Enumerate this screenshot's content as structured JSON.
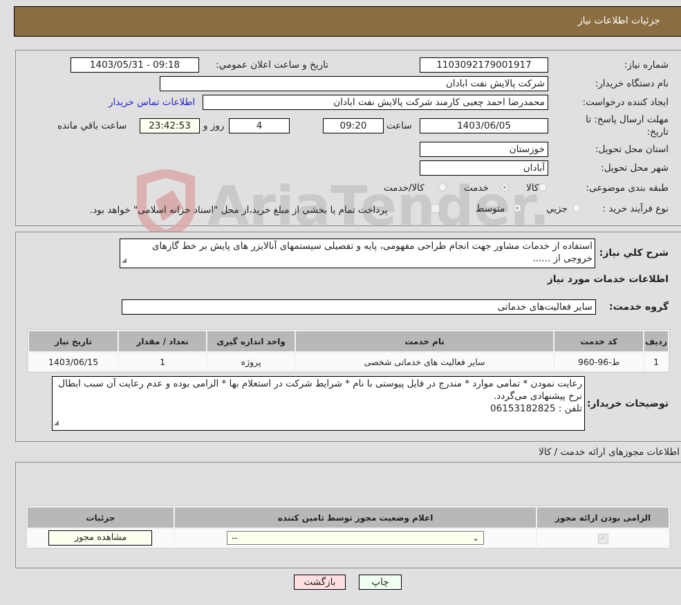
{
  "header": {
    "title": "جزئیات اطلاعات نیاز"
  },
  "details": {
    "need_number_label": "شماره نیاز:",
    "need_number": "1103092179001917",
    "announce_label": "تاریخ و ساعت اعلان عمومي:",
    "announce_value": "1403/05/31 - 09:18",
    "buyer_org_label": "نام دستگاه خریدار:",
    "buyer_org": "شرکت پالایش نفت ابادان",
    "creator_label": "ایجاد کننده درخواست:",
    "creator": "محمدرضا احمد چعبی کارمند شرکت پالایش نفت ابادان",
    "buyer_contact_link": "اطلاعات تماس خریدار",
    "deadline_label": "مهلت ارسال پاسخ: تا تاریخ:",
    "deadline_date": "1403/06/05",
    "time_label": "ساعت",
    "deadline_time": "09:20",
    "days_value": "4",
    "days_label": "روز و",
    "remaining_time": "23:42:53",
    "remaining_label": "ساعت باقي مانده",
    "province_label": "استان محل تحویل:",
    "province": "خوزستان",
    "city_label": "شهر محل تحویل:",
    "city": "آبادان",
    "category_label": "طبقه بندی موضوعی:",
    "category_options": [
      "کالا",
      "خدمت",
      "کالا/خدمت"
    ],
    "category_selected": "خدمت",
    "process_label": "نوع فرآیند خرید :",
    "process_options": [
      "جزيي",
      "متوسط"
    ],
    "process_selected": "متوسط",
    "treasury_note": "پرداخت تمام یا بخشی از مبلغ خرید،از محل \"اسناد خزانه اسلامی\" خواهد بود."
  },
  "description": {
    "label": "شرح کلي نیاز:",
    "text": "استفاده از خدمات مشاور جهت انجام طراحی مفهومی، پایه و تفصیلی سیستمهای آنالایزر های پایش بر خط گازهای خروجی از ......",
    "services_heading": "اطلاعات خدمات مورد نیاز",
    "service_group_label": "گروه خدمت:",
    "service_group": "سایر فعالیت‌های خدماتی"
  },
  "services_table": {
    "headers": [
      "ردیف",
      "کد خدمت",
      "نام خدمت",
      "واحد اندازه گیری",
      "تعداد / مقدار",
      "تاریخ نیاز"
    ],
    "rows": [
      [
        "1",
        "ط-96-960",
        "سایر فعالیت های خدماتی شخصی",
        "پروژه",
        "1",
        "1403/06/15"
      ]
    ]
  },
  "buyer_notes": {
    "label": "توضیحات خریدار:",
    "line1": "رعایت نمودن * تمامی موارد * مندرج در فایل پیوستی با نام * شرایط شرکت در استعلام بها * الزامی بوده و عدم رعایت آن سبب ابطال نرخ پیشنهادی می‌گردد.",
    "line2": "تلفن : 06153182825"
  },
  "permits": {
    "title": "اطلاعات مجوزهای ارائه خدمت / کالا",
    "headers": [
      "الزامی بودن ارائه مجوز",
      "اعلام وضعیت مجوز توسط تامین کننده",
      "جزئیات"
    ],
    "select_value": "--",
    "view_button": "مشاهده مجوز"
  },
  "footer": {
    "print_button": "چاپ",
    "back_button": "بازگشت"
  },
  "watermark": {
    "text": "AriaTender.neT"
  }
}
